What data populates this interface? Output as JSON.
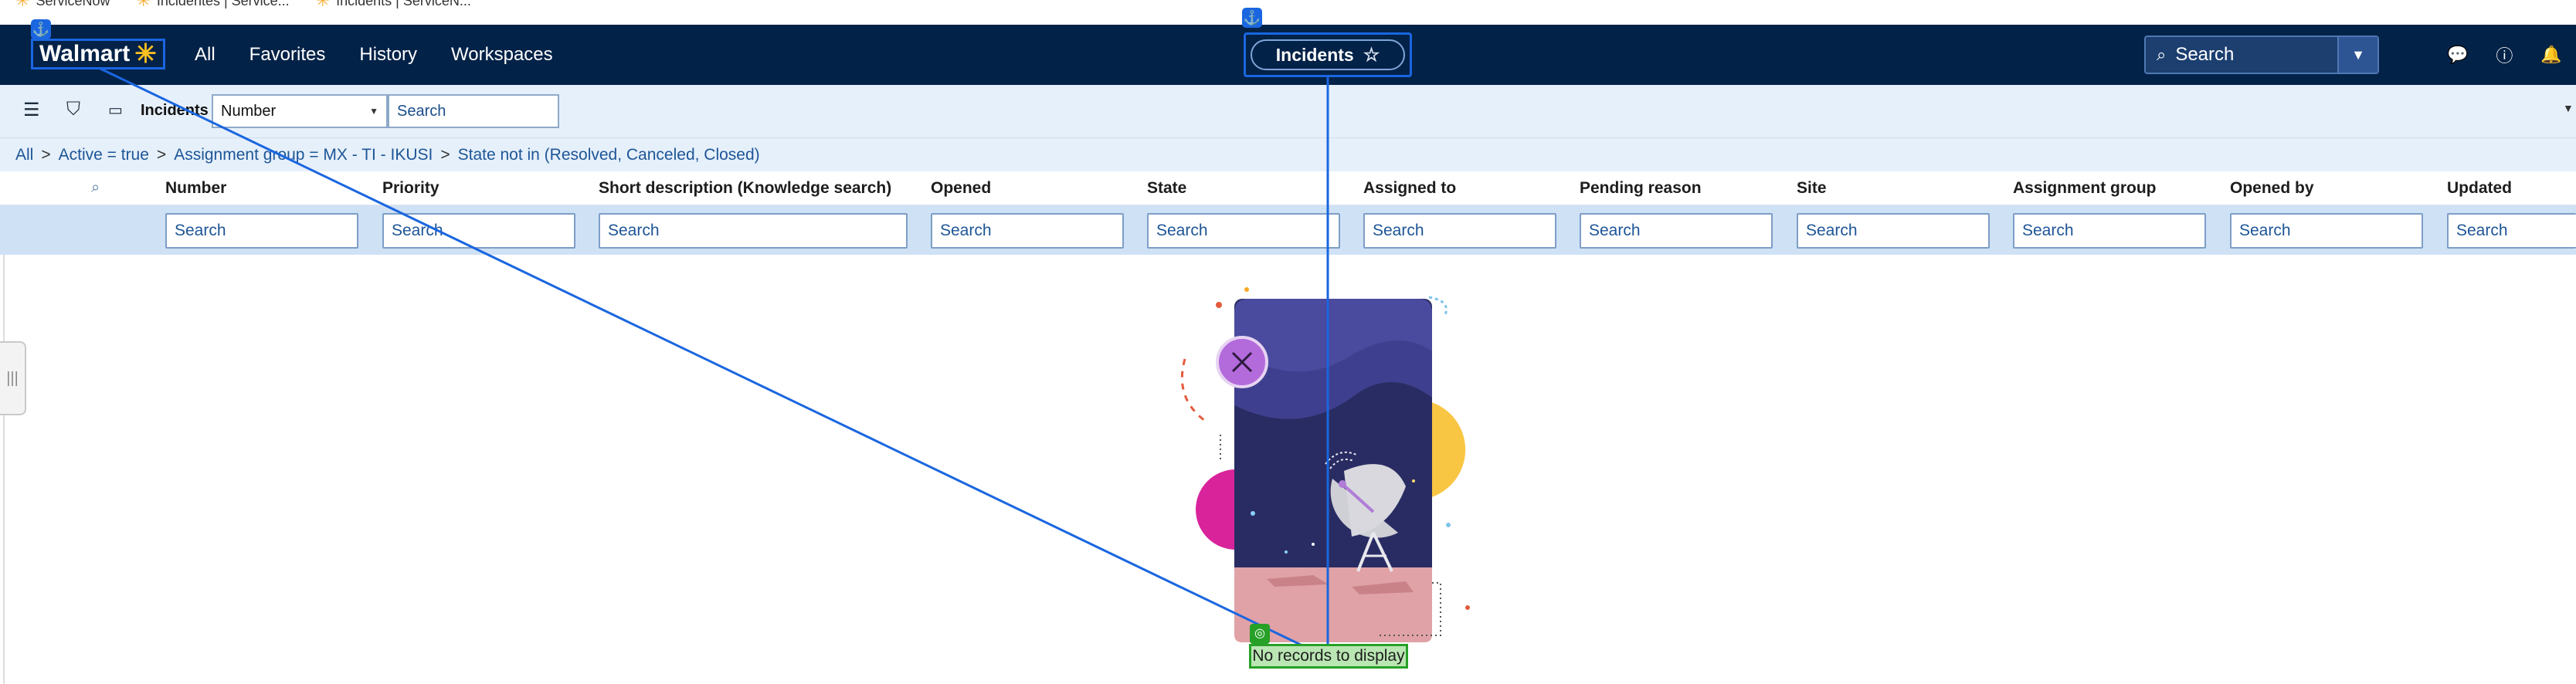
{
  "bookmarks": [
    {
      "label": "ServiceNow"
    },
    {
      "label": "Incidentes | Service..."
    },
    {
      "label": "Incidents | ServiceN..."
    }
  ],
  "nav": {
    "logo_text": "Walmart",
    "menu": [
      "All",
      "Favorites",
      "History",
      "Workspaces"
    ],
    "page_title": "Incidents",
    "search_placeholder": "Search"
  },
  "list": {
    "title": "Incidents",
    "search_field": "Number",
    "search_placeholder": "Search"
  },
  "breadcrumb": [
    "All",
    "Active = true",
    "Assignment group = MX - TI - IKUSI",
    "State not in (Resolved, Canceled, Closed)"
  ],
  "columns": [
    "Number",
    "Priority",
    "Short description (Knowledge search)",
    "Opened",
    "State",
    "Assigned to",
    "Pending reason",
    "Site",
    "Assignment group",
    "Opened by",
    "Updated"
  ],
  "filter_placeholder": "Search",
  "empty_state": {
    "message": "No records to display"
  },
  "colors": {
    "nav_bg": "#032248",
    "accent": "#1a66e0",
    "link": "#1d5597",
    "empty_highlight": "#27a027"
  },
  "icons": [
    "hamburger-icon",
    "filter-icon",
    "chat-icon",
    "search-icon",
    "chevron-down-icon",
    "star-icon",
    "chat-bubbles-icon",
    "help-icon",
    "bell-icon",
    "anchor-icon"
  ]
}
